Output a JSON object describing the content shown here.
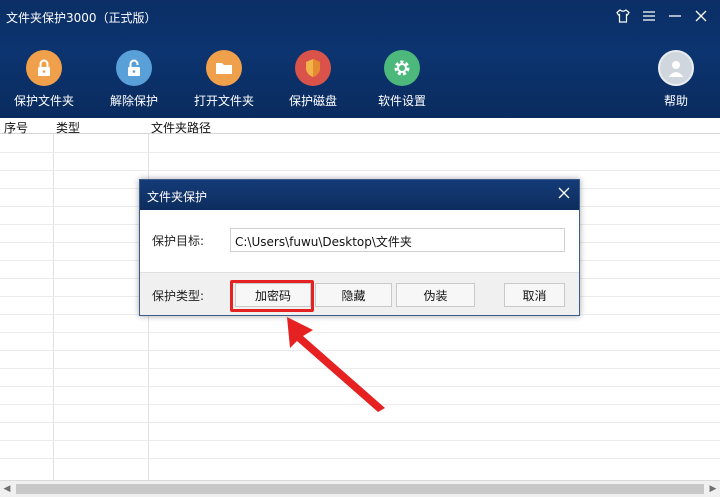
{
  "app": {
    "title": "文件夹保护3000（正式版）"
  },
  "toolbar": {
    "items": [
      {
        "label": "保护文件夹",
        "icon": "lock-folder-icon",
        "color": "#f0a04a"
      },
      {
        "label": "解除保护",
        "icon": "unlock-icon",
        "color": "#5aa0d8"
      },
      {
        "label": "打开文件夹",
        "icon": "folder-icon",
        "color": "#f0a04a"
      },
      {
        "label": "保护磁盘",
        "icon": "shield-icon",
        "color": "#d9534a"
      },
      {
        "label": "软件设置",
        "icon": "gear-icon",
        "color": "#4cb87c"
      }
    ],
    "help": {
      "label": "帮助",
      "icon": "user-help-icon"
    }
  },
  "table": {
    "columns": [
      "序号",
      "类型",
      "文件夹路径"
    ]
  },
  "dialog": {
    "title": "文件夹保护",
    "target_label": "保护目标:",
    "target_value": "C:\\Users\\fuwu\\Desktop\\文件夹",
    "type_label": "保护类型:",
    "buttons": {
      "encrypt": "加密码",
      "hide": "隐藏",
      "fake": "伪装",
      "cancel": "取消"
    }
  },
  "colors": {
    "header": "#0c3470",
    "highlight": "#e52121"
  }
}
